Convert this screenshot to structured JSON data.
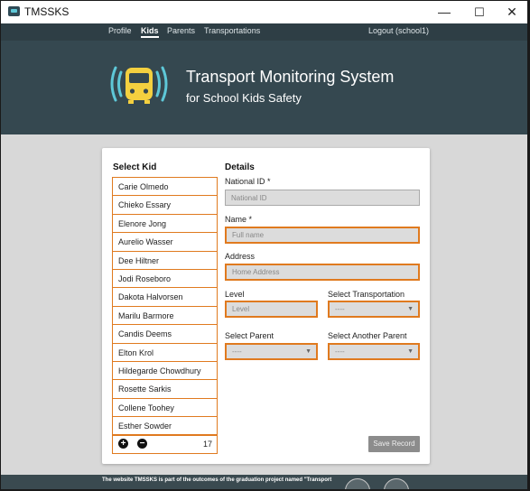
{
  "window": {
    "title": "TMSSKS",
    "controls": {
      "minimize": "—",
      "maximize": "☐",
      "close": "✕"
    }
  },
  "nav": {
    "items": [
      "Profile",
      "Kids",
      "Parents",
      "Transportations"
    ],
    "active": "Kids",
    "logout": "Logout (school1)"
  },
  "hero": {
    "title": "Transport Monitoring System",
    "subtitle": "for School Kids Safety",
    "icon": "bus-signal-icon",
    "colors": {
      "bus": "#f4d03f",
      "signal": "#5ec8d8"
    }
  },
  "kids": {
    "heading": "Select Kid",
    "items": [
      "Carie Olmedo",
      "Chieko Essary",
      "Elenore Jong",
      "Aurelio Wasser",
      "Dee Hiltner",
      "Jodi Roseboro",
      "Dakota Halvorsen",
      "Marilu Barmore",
      "Candis Deems",
      "Elton Krol",
      "Hildegarde Chowdhury",
      "Rosette Sarkis",
      "Collene Toohey",
      "Esther Sowder"
    ],
    "add_icon": "+",
    "remove_icon": "−",
    "count": "17"
  },
  "details": {
    "heading": "Details",
    "national_id": {
      "label": "National ID *",
      "placeholder": "National ID"
    },
    "name": {
      "label": "Name *",
      "placeholder": "Full name"
    },
    "address": {
      "label": "Address",
      "placeholder": "Home Address"
    },
    "level": {
      "label": "Level",
      "placeholder": "Level"
    },
    "transportation": {
      "label": "Select Transportation",
      "value": "----"
    },
    "parent": {
      "label": "Select Parent",
      "value": "----"
    },
    "another_parent": {
      "label": "Select Another Parent",
      "value": "----"
    },
    "save": "Save Record"
  },
  "footer": {
    "text": "The website TMSSKS is part of the outcomes of the graduation project named \"Transport"
  },
  "colors": {
    "accent": "#e07a1f",
    "nav": "#2e3e45",
    "hero": "#354850"
  }
}
